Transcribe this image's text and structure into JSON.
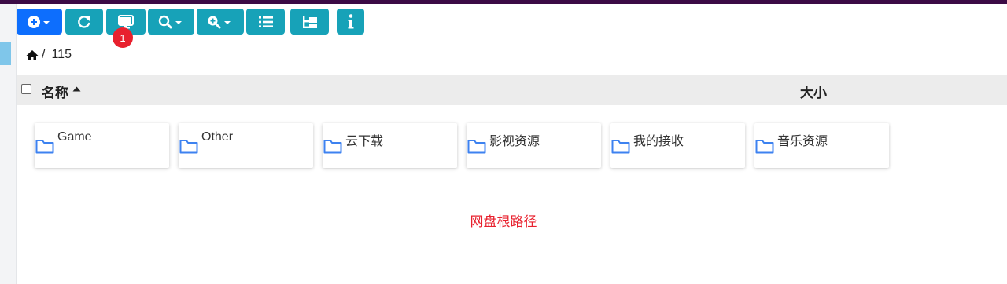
{
  "toolbar": {
    "buttons": [
      {
        "name": "add",
        "icon": "plus-circle-caret-icon",
        "color": "#0d6efd"
      },
      {
        "name": "refresh",
        "icon": "refresh-icon",
        "color": "#17a2b8"
      },
      {
        "name": "desktop",
        "icon": "monitor-icon",
        "color": "#17a2b8"
      },
      {
        "name": "search",
        "icon": "search-caret-icon",
        "color": "#17a2b8"
      },
      {
        "name": "zoom",
        "icon": "zoom-plus-caret-icon",
        "color": "#17a2b8"
      },
      {
        "name": "list-view",
        "icon": "list-icon",
        "color": "#17a2b8"
      },
      {
        "name": "tree-view",
        "icon": "tree-icon",
        "color": "#17a2b8"
      },
      {
        "name": "info",
        "icon": "info-icon",
        "color": "#17a2b8"
      }
    ],
    "badge_count": "1"
  },
  "breadcrumb": {
    "home_icon": "home-icon",
    "separator": "/",
    "current": "115"
  },
  "table_header": {
    "name_label": "名称",
    "size_label": "大小",
    "sort_icon": "caret-up-icon"
  },
  "folders": [
    {
      "label": "Game",
      "icon": "folder-icon"
    },
    {
      "label": "Other",
      "icon": "folder-icon"
    },
    {
      "label": "云下载",
      "icon": "folder-icon"
    },
    {
      "label": "影视资源",
      "icon": "folder-icon"
    },
    {
      "label": "我的接收",
      "icon": "folder-icon"
    },
    {
      "label": "音乐资源",
      "icon": "folder-icon"
    }
  ],
  "status_note": "网盘根路径",
  "colors": {
    "accent_blue": "#0d6efd",
    "info_teal": "#17a2b8",
    "badge_red": "#e8212e",
    "header_bg": "#ececec",
    "folder_blue": "#3d82f0"
  }
}
